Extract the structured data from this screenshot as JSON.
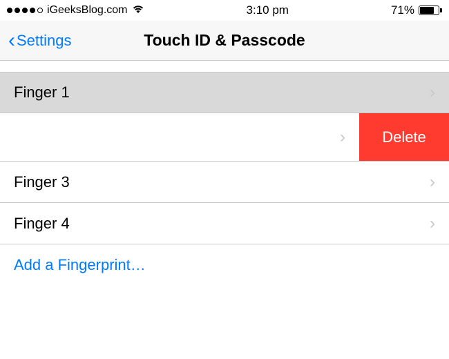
{
  "status_bar": {
    "carrier": "iGeeksBlog.com",
    "time": "3:10 pm",
    "battery_percent": "71%"
  },
  "nav": {
    "back_label": "Settings",
    "title": "Touch ID & Passcode"
  },
  "fingers": {
    "row1_label": "Finger 1",
    "row2_label": "",
    "row2_delete": "Delete",
    "row3_label": "Finger 3",
    "row4_label": "Finger 4"
  },
  "add_label": "Add a Fingerprint…"
}
